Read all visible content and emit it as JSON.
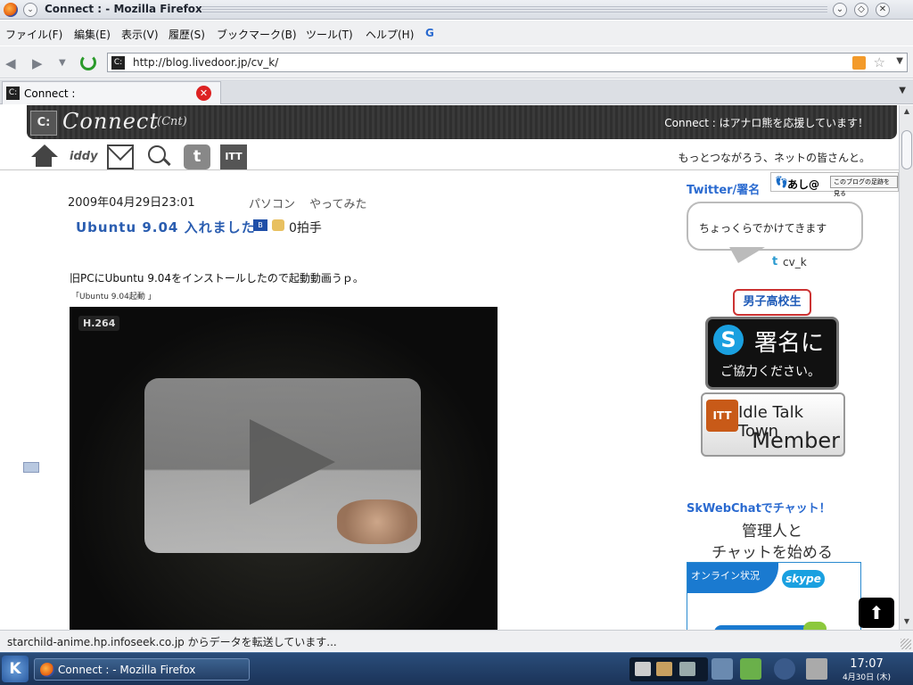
{
  "window": {
    "title": "Connect : - Mozilla Firefox"
  },
  "menu": {
    "items": [
      "ファイル(F)",
      "編集(E)",
      "表示(V)",
      "履歴(S)",
      "ブックマーク(B)",
      "ツール(T)",
      "ヘルプ(H)"
    ],
    "google_label": "G"
  },
  "nav": {
    "url": "http://blog.livedoor.jp/cv_k/"
  },
  "tabs": [
    {
      "label": "Connect :"
    }
  ],
  "blog": {
    "logo_text": "Connect",
    "logo_sub": "(Cnt)",
    "logo_mark": "C:",
    "header_tagline": "Connect : はアナロ熊を応援しています！",
    "slogan": "もっとつながろう、ネットの皆さんと。",
    "nav_icons": [
      "home-icon",
      "iddy-icon",
      "mail-icon",
      "search-icon",
      "twitter-icon",
      "itt-icon"
    ],
    "iddy_label": "iddy",
    "itt_label": "ITT"
  },
  "post": {
    "date": "2009年04月29日23:01",
    "categories": [
      "パソコン",
      "やってみた"
    ],
    "title": "Ubuntu 9.04 入れました",
    "clap_count": "0拍手",
    "body": "旧PCにUbuntu 9.04をインストールしたので起動動画うｐ。",
    "caption": "「Ubuntu 9.04起動 」",
    "video_badge": "H.264"
  },
  "sidebar": {
    "twitter_title": "Twitter/署名",
    "ashi_label": "あし@",
    "ashi_link": "このブログの足跡を見る",
    "bubble_text": "ちょっくらでかけてきます",
    "twitter_user": "cv_k",
    "danshi_label": "男子高校生",
    "skype_big": "署名に",
    "skype_sub": "ご協力ください。",
    "itt_name": "Idle Talk Town",
    "itt_member": "Member",
    "chat_title": "SkWebChatでチャット！",
    "chat_text_1": "管理人と",
    "chat_text_2": "チャットを始める",
    "online_label": "オンライン状況",
    "skype_logo": "skype"
  },
  "status": {
    "text": "starchild-anime.hp.infoseek.co.jp からデータを転送しています..."
  },
  "taskbar": {
    "task_label": "Connect : - Mozilla Firefox",
    "time": "17:07",
    "date": "4月30日 (木)"
  }
}
